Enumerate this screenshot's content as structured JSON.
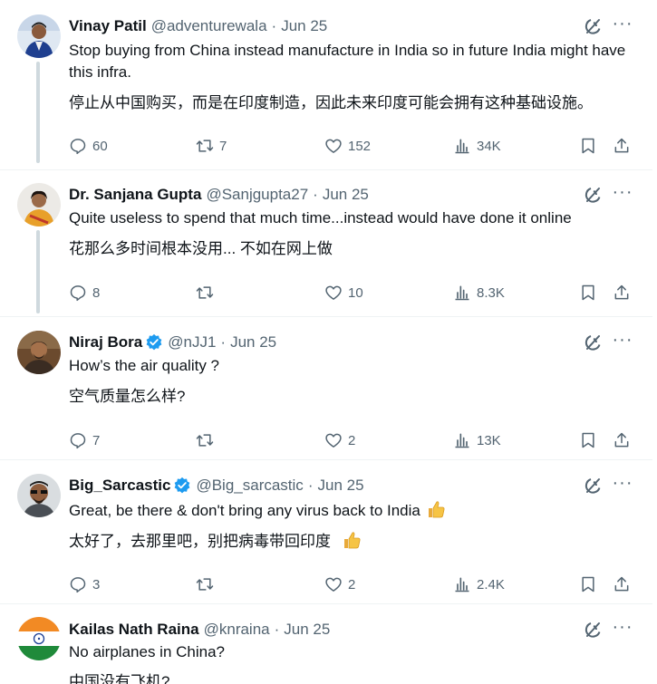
{
  "tweets": [
    {
      "name": "Vinay Patil",
      "handle": "@adventurewala",
      "sep": "·",
      "date": "Jun 25",
      "text": "Stop buying from China instead manufacture in India so in future India might have this infra.",
      "translation": "停止从中国购买，而是在印度制造，因此未来印度可能会拥有这种基础设施。",
      "replies": "60",
      "retweets": "7",
      "likes": "152",
      "views": "34K",
      "verified": false
    },
    {
      "name": "Dr. Sanjana Gupta",
      "handle": "@Sanjgupta27",
      "sep": "·",
      "date": "Jun 25",
      "text": "Quite useless to spend that much time...instead would have done it online",
      "translation": "花那么多时间根本没用... 不如在网上做",
      "replies": "8",
      "retweets": "",
      "likes": "10",
      "views": "8.3K",
      "verified": false
    },
    {
      "name": "Niraj Bora",
      "handle": "@nJJ1",
      "sep": "·",
      "date": "Jun 25",
      "text": "How’s the air quality ?",
      "translation": "空气质量怎么样?",
      "replies": "7",
      "retweets": "",
      "likes": "2",
      "views": "13K",
      "verified": true
    },
    {
      "name": "Big_Sarcastic",
      "handle": "@Big_sarcastic",
      "sep": "·",
      "date": "Jun 25",
      "text": "Great, be there & don't bring any virus back to India",
      "translation": "太好了，去那里吧，别把病毒带回印度",
      "replies": "3",
      "retweets": "",
      "likes": "2",
      "views": "2.4K",
      "verified": true
    },
    {
      "name": "Kailas Nath Raina",
      "handle": "@knraina",
      "sep": "·",
      "date": "Jun 25",
      "text": "No airplanes in China?",
      "translation": "中国没有飞机?",
      "verified": false
    }
  ],
  "icons": {
    "more": "···",
    "grok": "grok-icon",
    "reply": "reply-icon",
    "retweet": "retweet-icon",
    "like": "like-icon",
    "views": "views-icon",
    "bookmark": "bookmark-icon",
    "share": "share-icon",
    "thumbs_up": "thumbs-up-emoji"
  },
  "colors": {
    "text": "#0f1419",
    "secondary": "#536471",
    "verified": "#1d9bf0",
    "divider": "#eff3f4",
    "thread_line": "#cfd9de"
  }
}
